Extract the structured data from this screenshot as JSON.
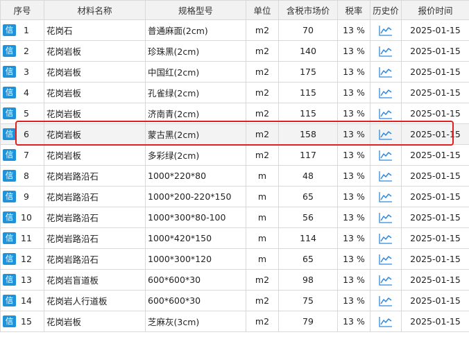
{
  "headers": {
    "seq": "序号",
    "material": "材料名称",
    "spec": "规格型号",
    "unit": "单位",
    "price": "含税市场价",
    "tax": "税率",
    "history": "历史价",
    "date": "报价时间"
  },
  "badge_label": "信",
  "history_icon": "line-chart-icon",
  "colors": {
    "badge": "#1f92d9",
    "highlight": "#e02020",
    "chart_icon": "#2b8ae0",
    "header_bg": "#f2f2f2"
  },
  "highlighted_row": 6,
  "rows": [
    {
      "no": "1",
      "name": "花岗石",
      "spec": "普通麻面(2cm)",
      "unit": "m2",
      "price": "70",
      "tax": "13 %",
      "date": "2025-01-15"
    },
    {
      "no": "2",
      "name": "花岗岩板",
      "spec": "珍珠黑(2cm)",
      "unit": "m2",
      "price": "140",
      "tax": "13 %",
      "date": "2025-01-15"
    },
    {
      "no": "3",
      "name": "花岗岩板",
      "spec": "中国红(2cm)",
      "unit": "m2",
      "price": "175",
      "tax": "13 %",
      "date": "2025-01-15"
    },
    {
      "no": "4",
      "name": "花岗岩板",
      "spec": "孔雀绿(2cm)",
      "unit": "m2",
      "price": "115",
      "tax": "13 %",
      "date": "2025-01-15"
    },
    {
      "no": "5",
      "name": "花岗岩板",
      "spec": "济南青(2cm)",
      "unit": "m2",
      "price": "115",
      "tax": "13 %",
      "date": "2025-01-15"
    },
    {
      "no": "6",
      "name": "花岗岩板",
      "spec": "蒙古黑(2cm)",
      "unit": "m2",
      "price": "158",
      "tax": "13 %",
      "date": "2025-01-15"
    },
    {
      "no": "7",
      "name": "花岗岩板",
      "spec": "多彩绿(2cm)",
      "unit": "m2",
      "price": "117",
      "tax": "13 %",
      "date": "2025-01-15"
    },
    {
      "no": "8",
      "name": "花岗岩路沿石",
      "spec": "1000*220*80",
      "unit": "m",
      "price": "48",
      "tax": "13 %",
      "date": "2025-01-15"
    },
    {
      "no": "9",
      "name": "花岗岩路沿石",
      "spec": "1000*200-220*150",
      "unit": "m",
      "price": "65",
      "tax": "13 %",
      "date": "2025-01-15"
    },
    {
      "no": "10",
      "name": "花岗岩路沿石",
      "spec": "1000*300*80-100",
      "unit": "m",
      "price": "56",
      "tax": "13 %",
      "date": "2025-01-15"
    },
    {
      "no": "11",
      "name": "花岗岩路沿石",
      "spec": "1000*420*150",
      "unit": "m",
      "price": "114",
      "tax": "13 %",
      "date": "2025-01-15"
    },
    {
      "no": "12",
      "name": "花岗岩路沿石",
      "spec": "1000*300*120",
      "unit": "m",
      "price": "65",
      "tax": "13 %",
      "date": "2025-01-15"
    },
    {
      "no": "13",
      "name": "花岗岩盲道板",
      "spec": "600*600*30",
      "unit": "m2",
      "price": "98",
      "tax": "13 %",
      "date": "2025-01-15"
    },
    {
      "no": "14",
      "name": "花岗岩人行道板",
      "spec": "600*600*30",
      "unit": "m2",
      "price": "75",
      "tax": "13 %",
      "date": "2025-01-15"
    },
    {
      "no": "15",
      "name": "花岗岩板",
      "spec": "芝麻灰(3cm)",
      "unit": "m2",
      "price": "79",
      "tax": "13 %",
      "date": "2025-01-15"
    }
  ]
}
